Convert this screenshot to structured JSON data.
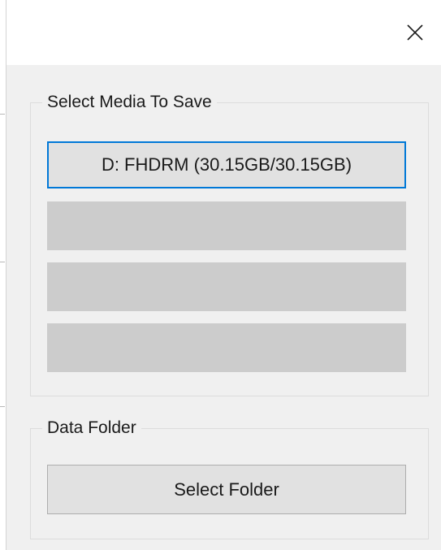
{
  "window": {
    "close_icon": "close-icon"
  },
  "media_group": {
    "legend": "Select Media To Save",
    "drives": [
      {
        "label": "D:  FHDRM (30.15GB/30.15GB)",
        "selected": true
      },
      {
        "label": "",
        "selected": false
      },
      {
        "label": "",
        "selected": false
      },
      {
        "label": "",
        "selected": false
      }
    ]
  },
  "folder_group": {
    "legend": "Data Folder",
    "select_folder_label": "Select Folder"
  },
  "colors": {
    "focus_border": "#0078d7",
    "button_face": "#e1e1e1",
    "disabled_face": "#cccccc",
    "dialog_background": "#f0f0f0"
  }
}
